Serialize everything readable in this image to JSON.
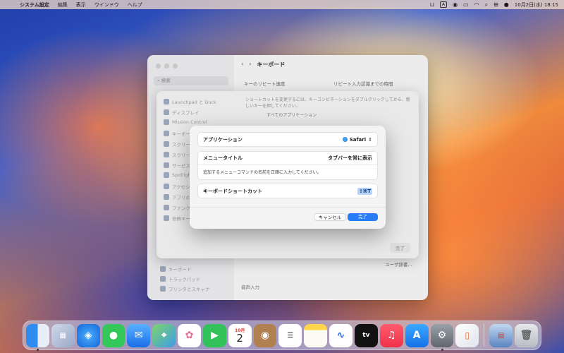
{
  "menubar": {
    "app": "システム設定",
    "items": [
      "編集",
      "表示",
      "ウインドウ",
      "ヘルプ"
    ],
    "input_indicator": "A",
    "datetime": "10月2日(水)  18:15"
  },
  "settings_window": {
    "search_placeholder": "検索",
    "title": "キーボード",
    "key_repeat_label": "キーのリピート速度",
    "repeat_delay_label": "リピート入力認識までの時間",
    "sidebar_items": [
      "キーボード",
      "トラックパッド",
      "プリンタとスキャナ"
    ],
    "voice_input_label": "音声入力",
    "shortcut_link": "ユーザ辞書..."
  },
  "sheet": {
    "description": "ショートカットを変更するには、キーコンビネーションをダブルクリックしてから、新しいキーを押してください。",
    "all_apps": "すべてのアプリケーション",
    "sidebar_items": [
      "Launchpad と Dock",
      "ディスプレイ",
      "Mission Control",
      "キーボード",
      "スクリーンショット",
      "スクリーン",
      "サービス",
      "Spotlight",
      "アクセシビリティ",
      "アプリのショートカット",
      "ファンクションキー",
      "修飾キー"
    ],
    "done_label": "完了"
  },
  "dialog": {
    "application_label": "アプリケーション",
    "application_value": "Safari",
    "menu_title_label": "メニュータイトル",
    "menu_title_value": "タブバーを常に表示",
    "hint": "追加するメニューコマンドの名前を正確に入力してください。",
    "shortcut_label": "キーボードショートカット",
    "shortcut_value": "⇧⌘T",
    "cancel_label": "キャンセル",
    "done_label": "完了"
  },
  "dock": {
    "calendar_month": "10月",
    "calendar_day": "2",
    "tv_label": "tv"
  },
  "colors": {
    "accent": "#2a7cf6",
    "shortcut_highlight": "#b8d4f8"
  }
}
